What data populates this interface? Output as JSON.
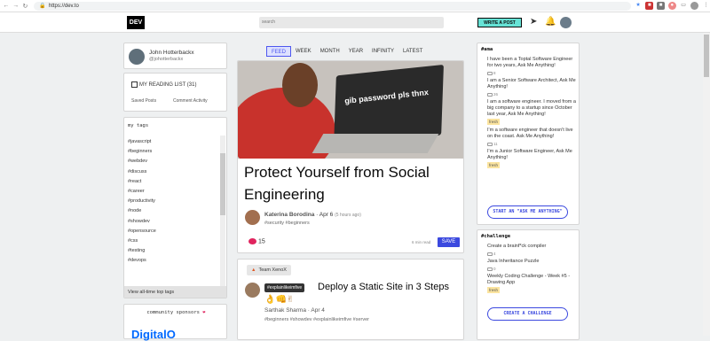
{
  "browser": {
    "url": "https://dev.to"
  },
  "header": {
    "logo": "DEV",
    "search_placeholder": "search",
    "write_post": "WRITE A POST"
  },
  "profile": {
    "name": "John Hotterbackx",
    "handle": "@johotterbackx"
  },
  "reading_list": {
    "label": "MY READING LIST (31)",
    "saved_posts": "Saved Posts",
    "comment_activity": "Comment Activity"
  },
  "tags": {
    "title": "my tags",
    "items": [
      "#javascript",
      "#beginners",
      "#webdev",
      "#discuss",
      "#react",
      "#career",
      "#productivity",
      "#node",
      "#showdev",
      "#opensource",
      "#css",
      "#testing",
      "#devops"
    ],
    "all_time": "View all-time top tags"
  },
  "sponsors": {
    "title": "community sponsors",
    "heart": "❤",
    "first": "DigitalO"
  },
  "feed": {
    "tabs": [
      "FEED",
      "WEEK",
      "MONTH",
      "YEAR",
      "INFINITY",
      "LATEST"
    ]
  },
  "featured": {
    "cover_text": "gib password pls thnx",
    "title": "Protect Yourself from Social Engineering",
    "author": "Katerina Borodina",
    "date": "Apr 6",
    "time_ago": "(5 hours ago)",
    "tags": "#security #beginners",
    "reactions": "15",
    "read_time": "6 min read",
    "save": "SAVE"
  },
  "second_post": {
    "org": "Team XenoX",
    "badge": "#explainlikeimfive",
    "title": "Deploy a Static Site in 3 Steps",
    "emoji": "👌👊✌",
    "author": "Sarthak Sharma",
    "date": "Apr 4",
    "tags": "#beginners #showdev #explainlikeimfive #server"
  },
  "ama": {
    "title": "#ama",
    "items": [
      {
        "text": "I have been a Toptal Software Engineer for two years, Ask Me Anything!",
        "count": "8",
        "fresh": ""
      },
      {
        "text": "I am a Senior Software Architect, Ask Me Anything!",
        "count": "26",
        "fresh": ""
      },
      {
        "text": "I am a software engineer. I moved from a big company to a startup since October last year, Ask Me Anything!",
        "count": "",
        "fresh": "fresh"
      },
      {
        "text": "I'm a software engineer that doesn't live on the coast. Ask Me Anything!",
        "count": "11",
        "fresh": ""
      },
      {
        "text": "I'm a Junior Software Engineer, Ask Me Anything!",
        "count": "",
        "fresh": "fresh"
      }
    ],
    "cta": "START AN \"ASK ME ANYTHING\""
  },
  "challenge": {
    "title": "#challenge",
    "items": [
      {
        "text": "Create a brainf*ck compiler",
        "count": "4",
        "fresh": ""
      },
      {
        "text": "Java Inheritance Puzzle",
        "count": "0",
        "fresh": ""
      },
      {
        "text": "Weekly Coding Challenge - Week #5 - Drawing App",
        "count": "",
        "fresh": "fresh"
      }
    ],
    "cta": "CREATE A CHALLENGE"
  }
}
